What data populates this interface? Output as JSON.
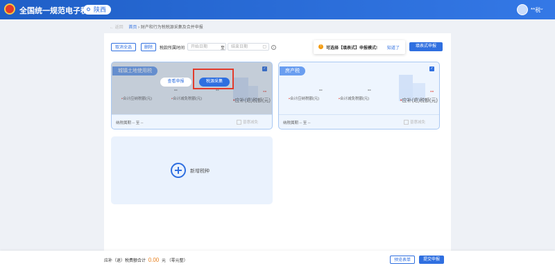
{
  "header": {
    "app_title": "全国统一规范电子税务局",
    "region": "陕西",
    "user": "**税"
  },
  "breadcrumb": {
    "back": "返回",
    "home": "首页",
    "current": "财产和行为税税源采集及合并申报"
  },
  "toolbar": {
    "cancel_all": "取消全选",
    "delete": "删除",
    "period_label": "税款所属时间",
    "start_placeholder": "开始日期",
    "separator": "至",
    "end_placeholder": "结束日期",
    "tip_text": "可选择【填表式】申报模式!",
    "tip_link": "知道了",
    "form_mode": "填表式申报"
  },
  "cards": [
    {
      "name": "城镇土地使用税",
      "checked": true,
      "hovered": true,
      "view_button": "查看申报",
      "collect_button": "税源采集",
      "payable": "--",
      "reduction": "--",
      "refund": "--",
      "payable_label": "合计应纳税额(元)",
      "reduction_label": "合计减免税额(元)",
      "refund_label": "应补(退)税额(元)",
      "period": "纳税属期 -- 至 --",
      "fold_label": "普惠减免"
    },
    {
      "name": "房产税",
      "checked": true,
      "hovered": false,
      "payable": "--",
      "reduction": "--",
      "refund": "--",
      "payable_label": "合计应纳税额(元)",
      "reduction_label": "合计减免税额(元)",
      "refund_label": "应补(退)税额(元)",
      "period": "纳税属期 -- 至 --",
      "fold_label": "普惠减免"
    }
  ],
  "add_tax": {
    "label": "新增税种"
  },
  "footer": {
    "total_label": "应补（退）税费额合计",
    "amount": "0.00",
    "unit": "元",
    "amount_words": "（零元整）",
    "preview": "预览表单",
    "submit": "提交申报"
  },
  "colors": {
    "primary": "#2f6fe0",
    "accent_red": "#e23a2b",
    "amount_orange": "#e8811f"
  }
}
